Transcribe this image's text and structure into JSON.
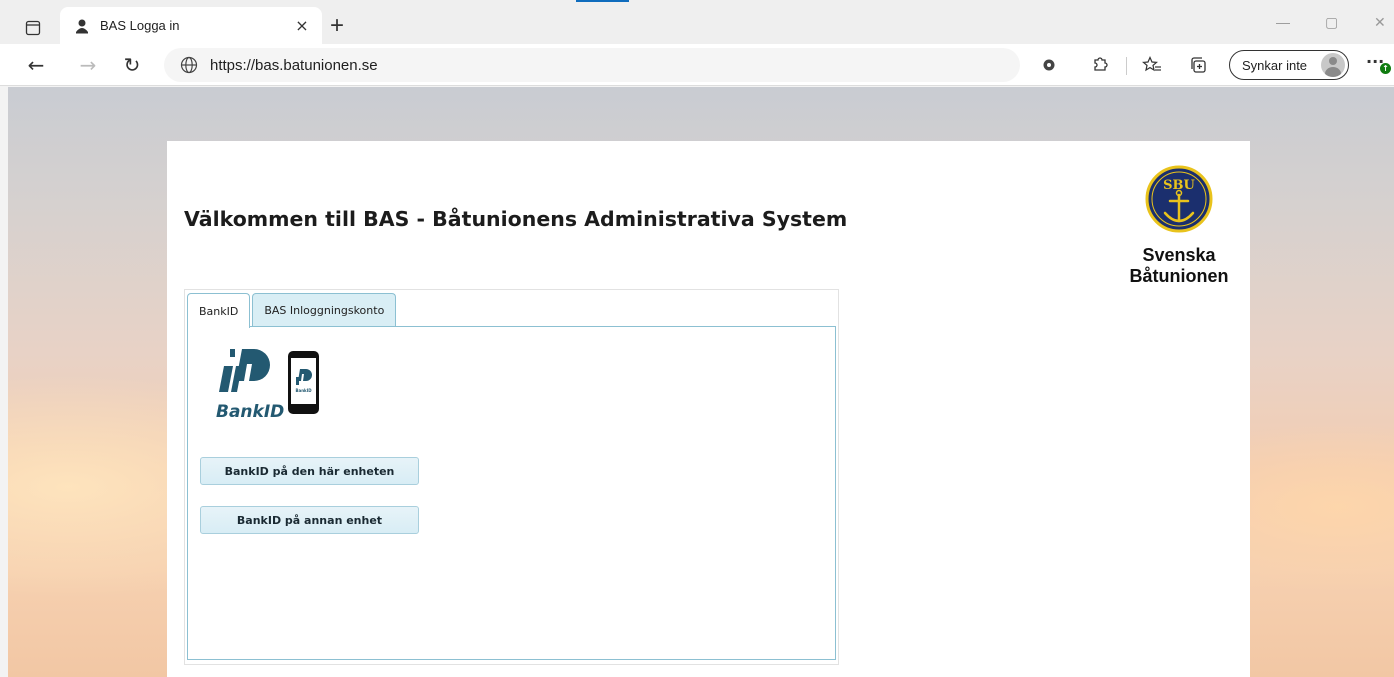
{
  "browser": {
    "tab_title": "BAS Logga in",
    "url": "https://bas.batunionen.se",
    "sync_label": "Synkar inte",
    "new_tab_glyph": "+",
    "close_tab_glyph": "×",
    "window_controls": {
      "minimize": "—",
      "maximize": "▢",
      "close": "✕"
    },
    "nav": {
      "back": "←",
      "forward": "→",
      "reload": "↻"
    },
    "more_glyph": "···"
  },
  "page": {
    "welcome_title": "Välkommen till BAS - Båtunionens Administrativa System",
    "logo": {
      "badge_text": "SBU",
      "line1": "Svenska",
      "line2": "Båtunionen"
    },
    "tabs": [
      {
        "label": "BankID",
        "active": true
      },
      {
        "label": "BAS Inloggningskonto",
        "active": false
      }
    ],
    "bankid": {
      "logo_text": "BankID",
      "buttons": {
        "this_device": "BankID på den här enheten",
        "other_device": "BankID på annan enhet"
      }
    }
  },
  "colors": {
    "tab_border": "#8cc0d2",
    "tab_inactive_bg": "#d9eef5",
    "bankid_blue": "#235971",
    "sbu_navy": "#1b2f6e",
    "sbu_gold": "#e9c31c",
    "accent": "#0f6cbd"
  }
}
